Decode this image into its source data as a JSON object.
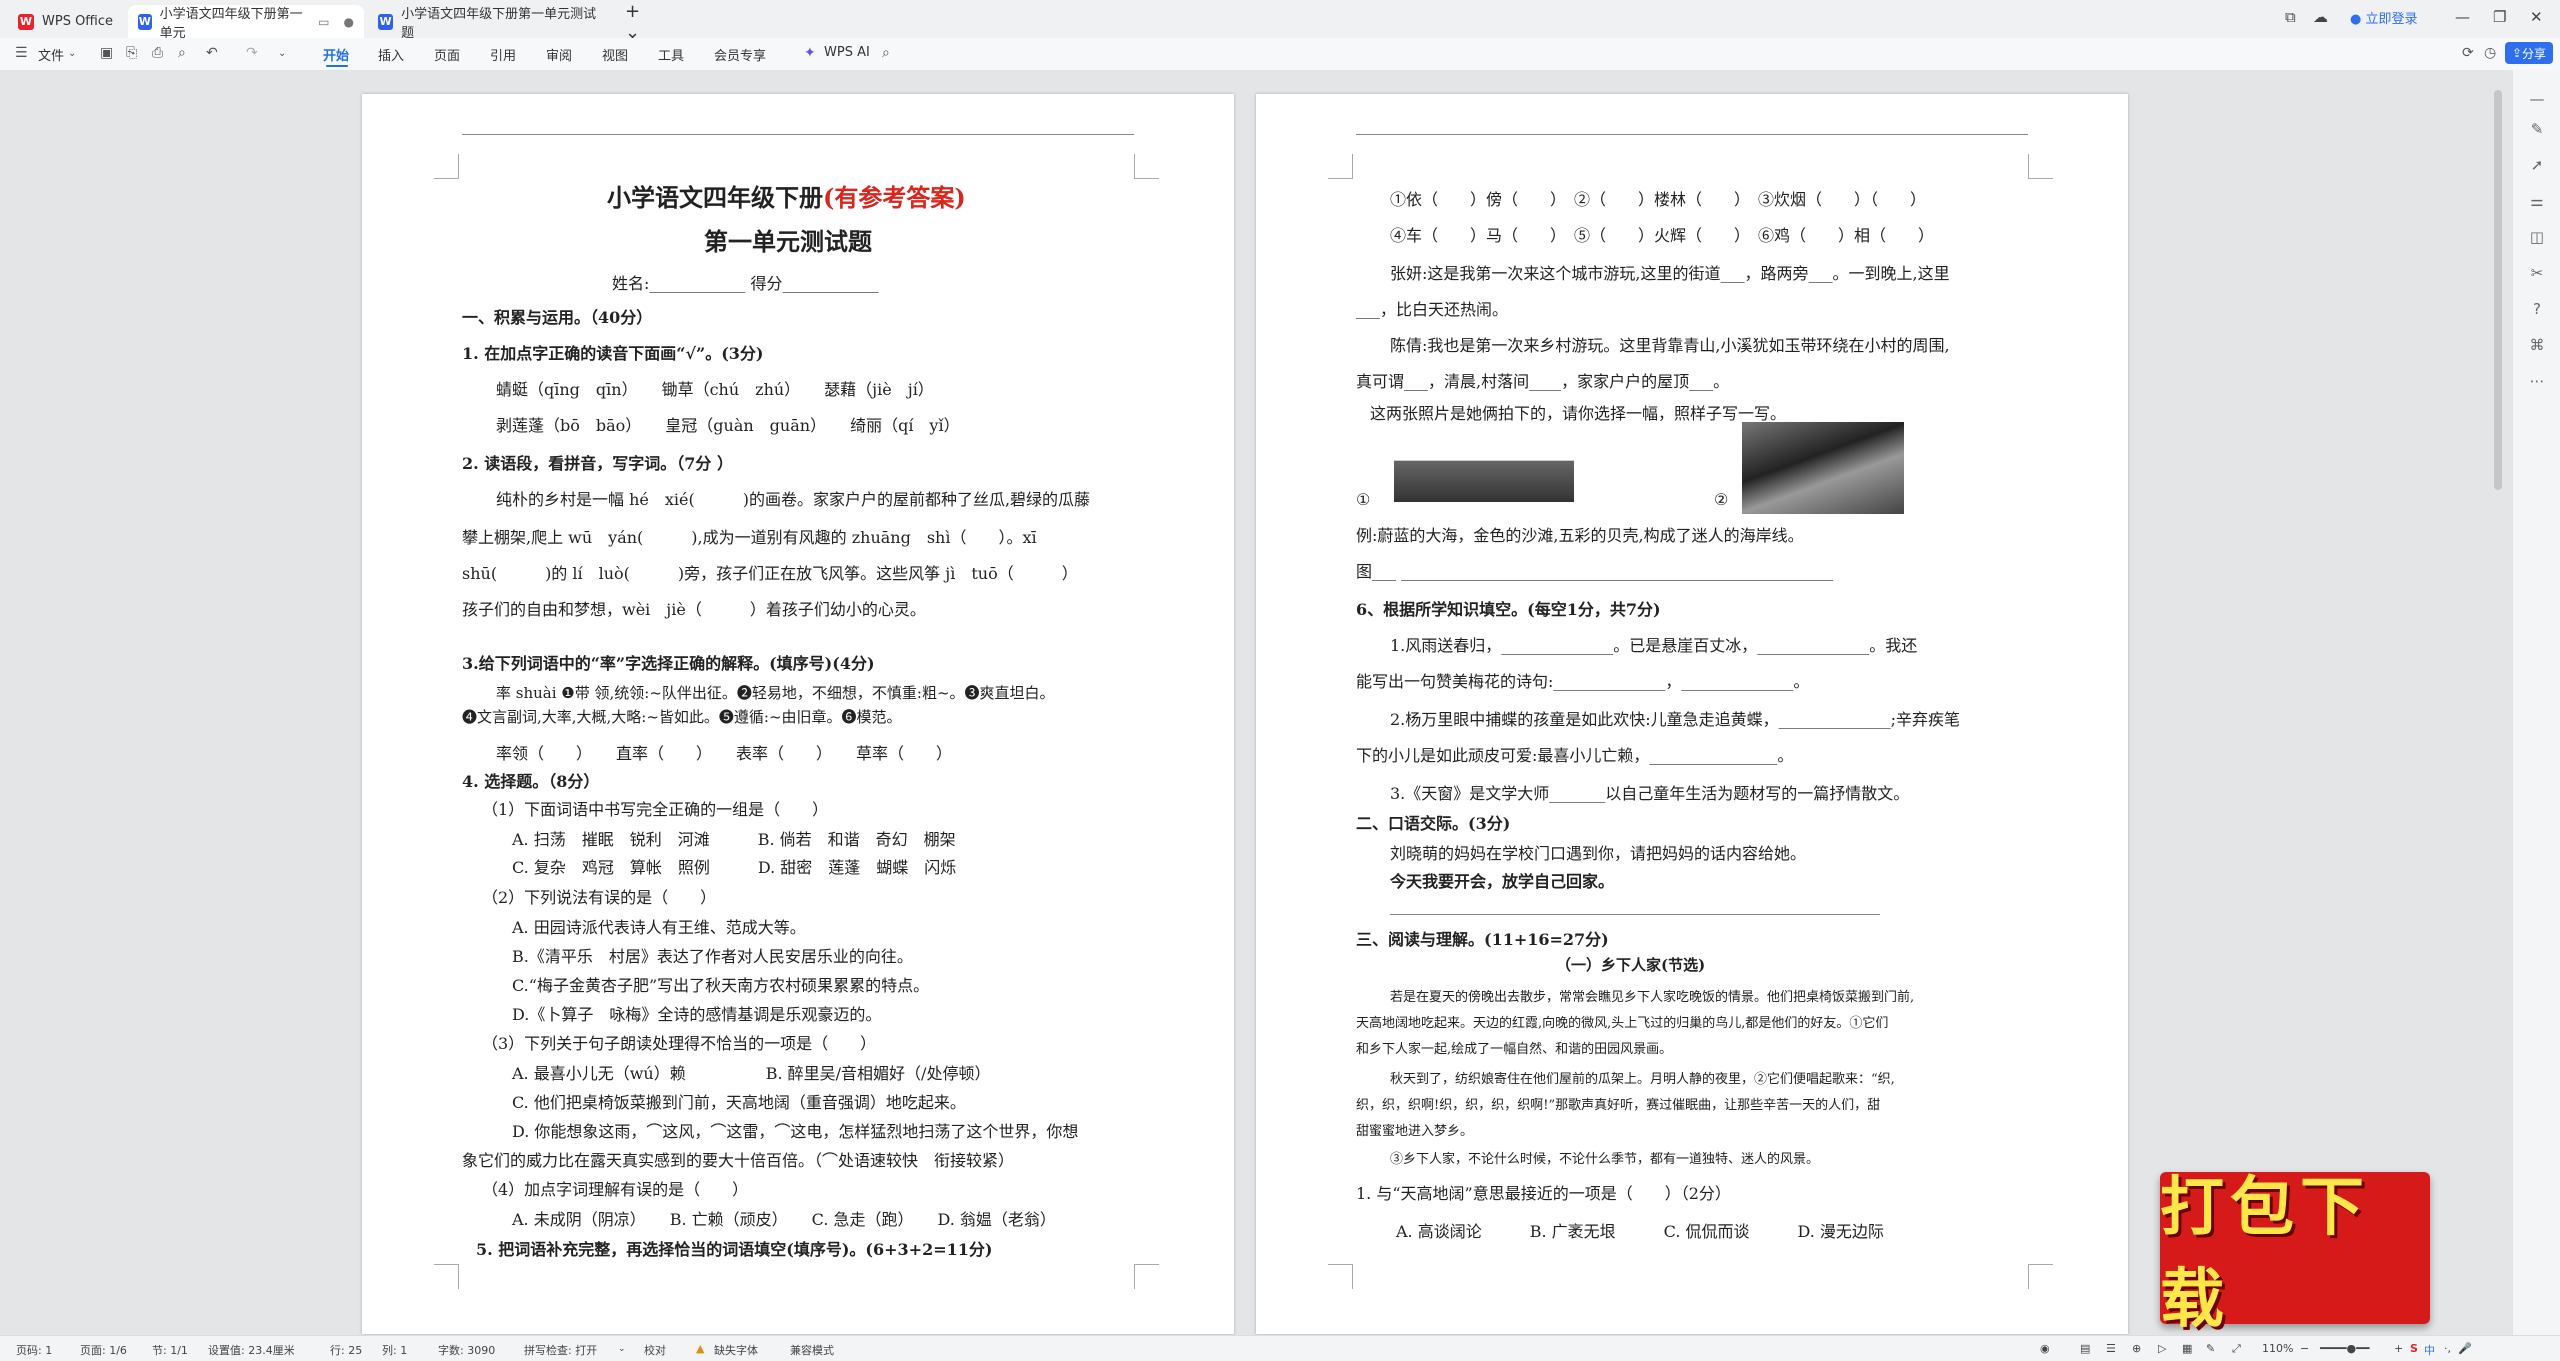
{
  "tabs": {
    "home": "WPS Office",
    "doc1": "小学语文四年级下册第一单元",
    "doc2": "小学语文四年级下册第一单元测试题",
    "login": "立即登录"
  },
  "toolbar": {
    "file": "文件",
    "start": "开始",
    "insert": "插入",
    "page": "页面",
    "reference": "引用",
    "review": "审阅",
    "view": "视图",
    "tools": "工具",
    "member": "会员专享",
    "ai": "WPS AI",
    "share": "分享"
  },
  "left_page": {
    "title_a": "小学语文四年级下册",
    "title_b": "(有参考答案)",
    "title2": "第一单元测试题",
    "name_row": "姓名:____________          得分____________",
    "lines": [
      "一、积累与运用。（40分）",
      "1. 在加点字正确的读音下面画“√”。(3分)",
      "蜻蜓（qīng　qīn）　　锄草（chú　zhú）　　瑟藉（jiè　jí）",
      "剥莲蓬（bō　bāo）　　皇冠（guàn　guān）　　绮丽（qí　yǐ）",
      "2. 读语段，看拼音，写字词。（7分 ）",
      "纯朴的乡村是一幅 hé　xié(　　　)的画卷。家家户户的屋前都种了丝瓜,碧绿的瓜藤",
      "攀上棚架,爬上 wū　yán(　　　),成为一道别有风趣的 zhuāng　shì（　　）。xī",
      "shū(　　　)的 lí　luò(　　　)旁，孩子们正在放飞风筝。这些风筝 jì　tuō（　　　）",
      "孩子们的自由和梦想，wèi　jiè（　　　）着孩子们幼小的心灵。",
      "3.给下列词语中的“率”字选择正确的解释。(填序号)(4分)",
      "率 shuài ❶带 领,统领:~队伴出征。❷轻易地，不细想，不慎重:粗~。❸爽直坦白。",
      "❹文言副词,大率,大概,大略:~皆如此。❺遵循:~由旧章。❻模范。",
      "率领（　　）　　直率（　　）　　表率（　　）　　草率（　　）",
      "4. 选择题。（8分）",
      "（1）下面词语中书写完全正确的一组是（　　）",
      "A. 扫荡　摧眠　锐利　河滩　　　B. 倘若　和谐　奇幻　棚架",
      "C. 复杂　鸡冠　算帐　照例　　　D. 甜密　莲蓬　蝴蝶　闪烁",
      "（2）下列说法有误的是（　　）",
      "A. 田园诗派代表诗人有王维、范成大等。",
      "B.《清平乐　村居》表达了作者对人民安居乐业的向往。",
      "C.“梅子金黄杏子肥”写出了秋天南方农村硕果累累的特点。",
      "D.《卜算子　咏梅》全诗的感情基调是乐观豪迈的。",
      "（3）下列关于句子朗读处理得不恰当的一项是（　　）",
      "A. 最喜小儿无（wú）赖　　　　　B. 醉里吴/音相媚好（/处停顿）",
      "C. 他们把桌椅饭菜搬到门前，天高地阔（重音强调）地吃起来。",
      "D. 你能想象这雨，⌒这风，⌒这雷，⌒这电，怎样猛烈地扫荡了这个世界，你想",
      "象它们的威力比在露天真实感到的要大十倍百倍。（⌒处语速较快　衔接较紧）",
      "（4）加点字词理解有误的是（　　）",
      "A. 未成阴（阴凉）　　B. 亡赖（顽皮）　　C. 急走（跑）　　D. 翁媪（老翁）",
      "5. 把词语补充完整，再选择恰当的词语填空(填序号)。(6+3+2=11分)"
    ]
  },
  "right_page": {
    "lines": [
      "①依（　　）傍（　　）　②（　　）楼林（　　）　③炊烟（　　）（　　）",
      "④车（　　）马（　　）　⑤（　　）火辉（　　）　⑥鸡（　　）相（　　）",
      "张妍:这是我第一次来这个城市游玩,这里的街道___，路两旁___。一到晚上,这里",
      "___，比白天还热闹。",
      "陈倩:我也是第一次来乡村游玩。这里背靠青山,小溪犹如玉带环绕在小村的周围,",
      "真可谓___，清晨,村落间____，家家户户的屋顶___。",
      "这两张照片是她俩拍下的，请你选择一幅，照样子写一写。",
      "①",
      "②",
      "例:蔚蓝的大海，金色的沙滩,五彩的贝壳,构成了迷人的海岸线。",
      "图___ ______________________________________________________",
      "6、根据所学知识填空。(每空1分，共7分)",
      "1.风雨送春归，______________。已是悬崖百丈冰，______________。我还",
      "能写出一句赞美梅花的诗句:______________，______________。",
      "2.杨万里眼中捕蝶的孩童是如此欢快:儿童急走追黄蝶，______________;辛弃疾笔",
      "下的小儿是如此顽皮可爱:最喜小儿亡赖，________________。",
      "3.《天窗》是文学大师_______以自己童年生活为题材写的一篇抒情散文。",
      "二、口语交际。(3分)",
      "刘晓萌的妈妈在学校门口遇到你，请把妈妈的话内容给她。",
      "今天我要开会，放学自己回家。",
      "三、阅读与理解。(11+16=27分)",
      "（一）乡下人家(节选)",
      "若是在夏天的傍晚出去散步，常常会瞧见乡下人家吃晚饭的情景。他们把桌椅饭菜搬到门前,",
      "天高地阔地吃起来。天边的红霞,向晚的微风,头上飞过的归巢的鸟儿,都是他们的好友。①它们",
      "和乡下人家一起,绘成了一幅自然、和谐的田园风景画。",
      "秋天到了，纺织娘寄住在他们屋前的瓜架上。月明人静的夜里，②它们便唱起歌来：“织,",
      "织，织，织啊!织，织，织，织啊!”那歌声真好听，赛过催眠曲，让那些辛苦一天的人们，甜",
      "甜蜜蜜地进入梦乡。",
      "③乡下人家，不论什么时候，不论什么季节，都有一道独特、迷人的风景。",
      "1. 与“天高地阔”意思最接近的一项是（　　）（2分）",
      "A. 高谈阔论　　　B. 广袤无垠　　　C. 侃侃而谈　　　D. 漫无边际"
    ]
  },
  "status": {
    "page_no": "页码: 1",
    "pages": "页面: 1/6",
    "section": "节: 1/1",
    "set_value": "设置值: 23.4厘米",
    "row": "行: 25",
    "col": "列: 1",
    "words": "字数: 3090",
    "spell": "拼写检查: 打开",
    "proof": "校对",
    "font_missing": "缺失字体",
    "compat": "兼容模式",
    "zoom": "110%"
  },
  "stamp": "打包下载"
}
